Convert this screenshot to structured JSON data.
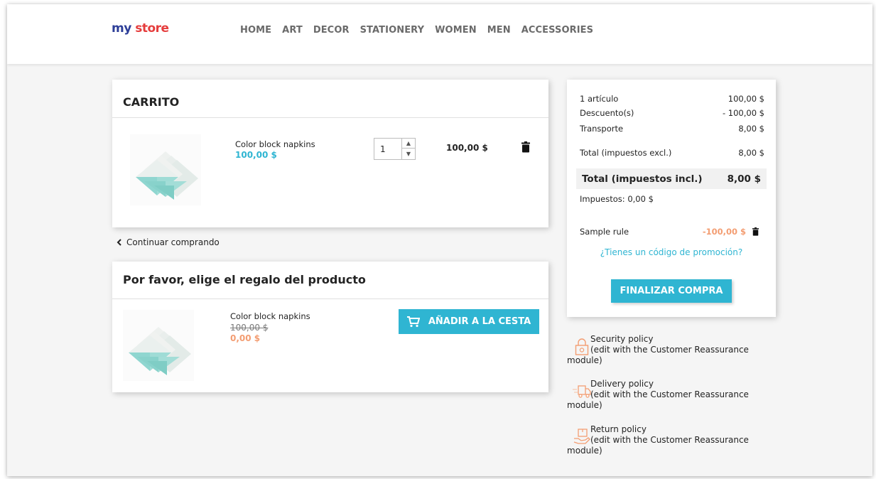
{
  "header": {
    "logo_part1": "my",
    "logo_part2": "store",
    "nav": [
      "HOME",
      "ART",
      "DECOR",
      "STATIONERY",
      "WOMEN",
      "MEN",
      "ACCESSORIES"
    ]
  },
  "cart": {
    "title": "CARRITO",
    "item": {
      "name": "Color block napkins",
      "price": "100,00 $",
      "quantity": "1",
      "line_total": "100,00 $"
    },
    "continue_label": "Continuar comprando"
  },
  "gift": {
    "title": "Por favor, elige el regalo del producto",
    "item": {
      "name": "Color block napkins",
      "old_price": "100,00 $",
      "new_price": "0,00 $"
    },
    "add_button": "AÑADIR A LA CESTA"
  },
  "summary": {
    "items_label": "1 artículo",
    "items_value": "100,00 $",
    "discount_label": "Descuento(s)",
    "discount_value": "- 100,00 $",
    "shipping_label": "Transporte",
    "shipping_value": "8,00 $",
    "total_excl_label": "Total (impuestos excl.)",
    "total_excl_value": "8,00 $",
    "total_incl_label": "Total (impuestos incl.)",
    "total_incl_value": "8,00 $",
    "taxes": "Impuestos: 0,00 $",
    "rule_label": "Sample rule",
    "rule_value": "-100,00 $",
    "promo_link": "¿Tienes un código de promoción?",
    "checkout_button": "FINALIZAR COMPRA"
  },
  "reassurance": [
    {
      "title": "Security policy",
      "line2": "(edit with the Customer Reassurance",
      "line3": "module)",
      "icon": "lock-icon"
    },
    {
      "title": "Delivery policy",
      "line2": "(edit with the Customer Reassurance",
      "line3": "module)",
      "icon": "truck-icon"
    },
    {
      "title": "Return policy",
      "line2": "(edit with the Customer Reassurance",
      "line3": "module)",
      "icon": "return-box-icon"
    }
  ],
  "colors": {
    "accent": "#2fb5d2",
    "discount": "#f39d72",
    "background": "#f5f5f5"
  }
}
